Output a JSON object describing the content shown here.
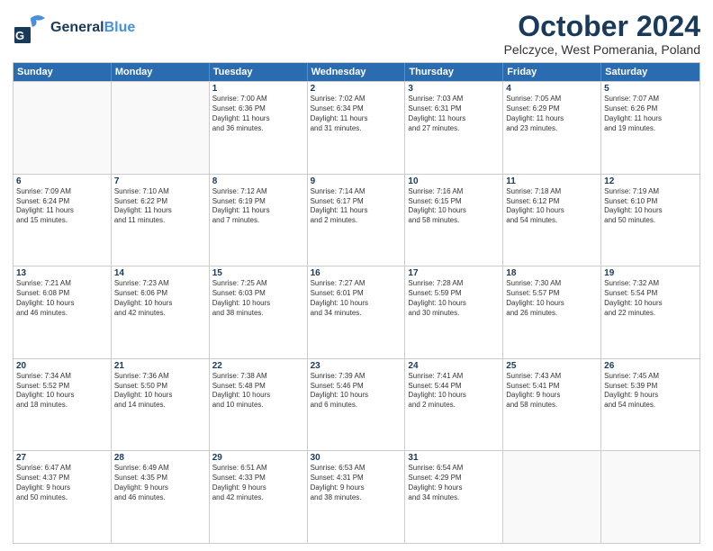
{
  "header": {
    "logo_line1": "General",
    "logo_line2": "Blue",
    "title": "October 2024",
    "subtitle": "Pelczyce, West Pomerania, Poland"
  },
  "days_of_week": [
    "Sunday",
    "Monday",
    "Tuesday",
    "Wednesday",
    "Thursday",
    "Friday",
    "Saturday"
  ],
  "weeks": [
    [
      {
        "day": "",
        "content": ""
      },
      {
        "day": "",
        "content": ""
      },
      {
        "day": "1",
        "content": "Sunrise: 7:00 AM\nSunset: 6:36 PM\nDaylight: 11 hours\nand 36 minutes."
      },
      {
        "day": "2",
        "content": "Sunrise: 7:02 AM\nSunset: 6:34 PM\nDaylight: 11 hours\nand 31 minutes."
      },
      {
        "day": "3",
        "content": "Sunrise: 7:03 AM\nSunset: 6:31 PM\nDaylight: 11 hours\nand 27 minutes."
      },
      {
        "day": "4",
        "content": "Sunrise: 7:05 AM\nSunset: 6:29 PM\nDaylight: 11 hours\nand 23 minutes."
      },
      {
        "day": "5",
        "content": "Sunrise: 7:07 AM\nSunset: 6:26 PM\nDaylight: 11 hours\nand 19 minutes."
      }
    ],
    [
      {
        "day": "6",
        "content": "Sunrise: 7:09 AM\nSunset: 6:24 PM\nDaylight: 11 hours\nand 15 minutes."
      },
      {
        "day": "7",
        "content": "Sunrise: 7:10 AM\nSunset: 6:22 PM\nDaylight: 11 hours\nand 11 minutes."
      },
      {
        "day": "8",
        "content": "Sunrise: 7:12 AM\nSunset: 6:19 PM\nDaylight: 11 hours\nand 7 minutes."
      },
      {
        "day": "9",
        "content": "Sunrise: 7:14 AM\nSunset: 6:17 PM\nDaylight: 11 hours\nand 2 minutes."
      },
      {
        "day": "10",
        "content": "Sunrise: 7:16 AM\nSunset: 6:15 PM\nDaylight: 10 hours\nand 58 minutes."
      },
      {
        "day": "11",
        "content": "Sunrise: 7:18 AM\nSunset: 6:12 PM\nDaylight: 10 hours\nand 54 minutes."
      },
      {
        "day": "12",
        "content": "Sunrise: 7:19 AM\nSunset: 6:10 PM\nDaylight: 10 hours\nand 50 minutes."
      }
    ],
    [
      {
        "day": "13",
        "content": "Sunrise: 7:21 AM\nSunset: 6:08 PM\nDaylight: 10 hours\nand 46 minutes."
      },
      {
        "day": "14",
        "content": "Sunrise: 7:23 AM\nSunset: 6:06 PM\nDaylight: 10 hours\nand 42 minutes."
      },
      {
        "day": "15",
        "content": "Sunrise: 7:25 AM\nSunset: 6:03 PM\nDaylight: 10 hours\nand 38 minutes."
      },
      {
        "day": "16",
        "content": "Sunrise: 7:27 AM\nSunset: 6:01 PM\nDaylight: 10 hours\nand 34 minutes."
      },
      {
        "day": "17",
        "content": "Sunrise: 7:28 AM\nSunset: 5:59 PM\nDaylight: 10 hours\nand 30 minutes."
      },
      {
        "day": "18",
        "content": "Sunrise: 7:30 AM\nSunset: 5:57 PM\nDaylight: 10 hours\nand 26 minutes."
      },
      {
        "day": "19",
        "content": "Sunrise: 7:32 AM\nSunset: 5:54 PM\nDaylight: 10 hours\nand 22 minutes."
      }
    ],
    [
      {
        "day": "20",
        "content": "Sunrise: 7:34 AM\nSunset: 5:52 PM\nDaylight: 10 hours\nand 18 minutes."
      },
      {
        "day": "21",
        "content": "Sunrise: 7:36 AM\nSunset: 5:50 PM\nDaylight: 10 hours\nand 14 minutes."
      },
      {
        "day": "22",
        "content": "Sunrise: 7:38 AM\nSunset: 5:48 PM\nDaylight: 10 hours\nand 10 minutes."
      },
      {
        "day": "23",
        "content": "Sunrise: 7:39 AM\nSunset: 5:46 PM\nDaylight: 10 hours\nand 6 minutes."
      },
      {
        "day": "24",
        "content": "Sunrise: 7:41 AM\nSunset: 5:44 PM\nDaylight: 10 hours\nand 2 minutes."
      },
      {
        "day": "25",
        "content": "Sunrise: 7:43 AM\nSunset: 5:41 PM\nDaylight: 9 hours\nand 58 minutes."
      },
      {
        "day": "26",
        "content": "Sunrise: 7:45 AM\nSunset: 5:39 PM\nDaylight: 9 hours\nand 54 minutes."
      }
    ],
    [
      {
        "day": "27",
        "content": "Sunrise: 6:47 AM\nSunset: 4:37 PM\nDaylight: 9 hours\nand 50 minutes."
      },
      {
        "day": "28",
        "content": "Sunrise: 6:49 AM\nSunset: 4:35 PM\nDaylight: 9 hours\nand 46 minutes."
      },
      {
        "day": "29",
        "content": "Sunrise: 6:51 AM\nSunset: 4:33 PM\nDaylight: 9 hours\nand 42 minutes."
      },
      {
        "day": "30",
        "content": "Sunrise: 6:53 AM\nSunset: 4:31 PM\nDaylight: 9 hours\nand 38 minutes."
      },
      {
        "day": "31",
        "content": "Sunrise: 6:54 AM\nSunset: 4:29 PM\nDaylight: 9 hours\nand 34 minutes."
      },
      {
        "day": "",
        "content": ""
      },
      {
        "day": "",
        "content": ""
      }
    ]
  ]
}
